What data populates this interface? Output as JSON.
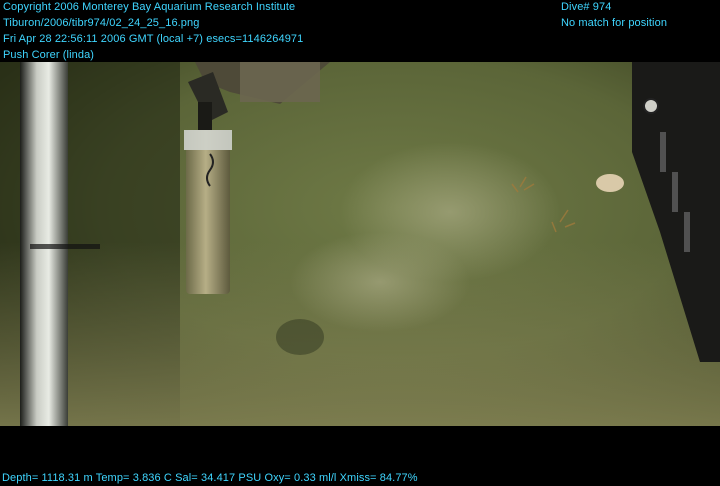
{
  "overlay": {
    "copyright": "Copyright 2006 Monterey Bay Aquarium Research Institute",
    "file_path": "Tiburon/2006/tibr974/02_24_25_16.png",
    "datetime": "Fri Apr 28 22:56:11 2006 GMT (local +7)  esecs=1146264971",
    "camera": "Push Corer (linda)",
    "dive": "Dive# 974",
    "position_status": "No match for position",
    "telemetry": "Depth= 1118.31 m  Temp= 3.836 C  Sal= 34.417 PSU  Oxy= 0.33 ml/l  Xmiss= 84.77%"
  },
  "colors": {
    "overlay_text": "#3fd6ff",
    "seafloor": "#5c6a3e",
    "water_haze": "#8b8d66"
  }
}
